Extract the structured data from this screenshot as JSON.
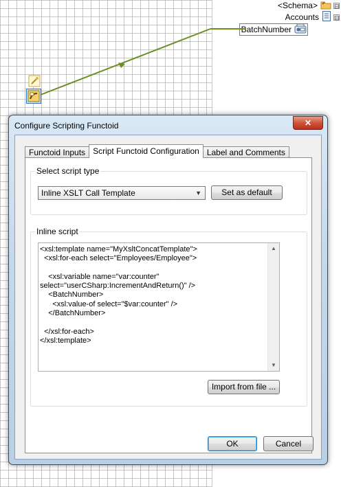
{
  "schema": {
    "nodes": [
      {
        "label": "<Schema>",
        "icon": "folder-icon"
      },
      {
        "label": "Accounts",
        "icon": "record-icon"
      },
      {
        "label": "BatchNumber",
        "icon": "field-icon"
      }
    ],
    "expander": "⊟"
  },
  "dialog": {
    "title": "Configure Scripting Functoid",
    "close_glyph": "✕",
    "tabs": [
      {
        "label": "Functoid Inputs",
        "active": false
      },
      {
        "label": "Script Functoid Configuration",
        "active": true
      },
      {
        "label": "Label and Comments",
        "active": false
      }
    ],
    "script_type": {
      "legend": "Select script type",
      "selected": "Inline XSLT Call Template",
      "set_default_label": "Set as default"
    },
    "inline_script": {
      "legend": "Inline script",
      "code": "<xsl:template name=\"MyXsltConcatTemplate\">\n  <xsl:for-each select=\"Employees/Employee\">\n\n    <xsl:variable name=\"var:counter\"\nselect=\"userCSharp:IncrementAndReturn()\" />\n    <BatchNumber>\n      <xsl:value-of select=\"$var:counter\" />\n    </BatchNumber>\n\n  </xsl:for-each>\n</xsl:template>",
      "import_label": "Import from file ..."
    },
    "ok_label": "OK",
    "cancel_label": "Cancel"
  },
  "colors": {
    "link": "#6b8e23",
    "close_button": "#c94a33",
    "dialog_frame": "#c5d9ec"
  }
}
